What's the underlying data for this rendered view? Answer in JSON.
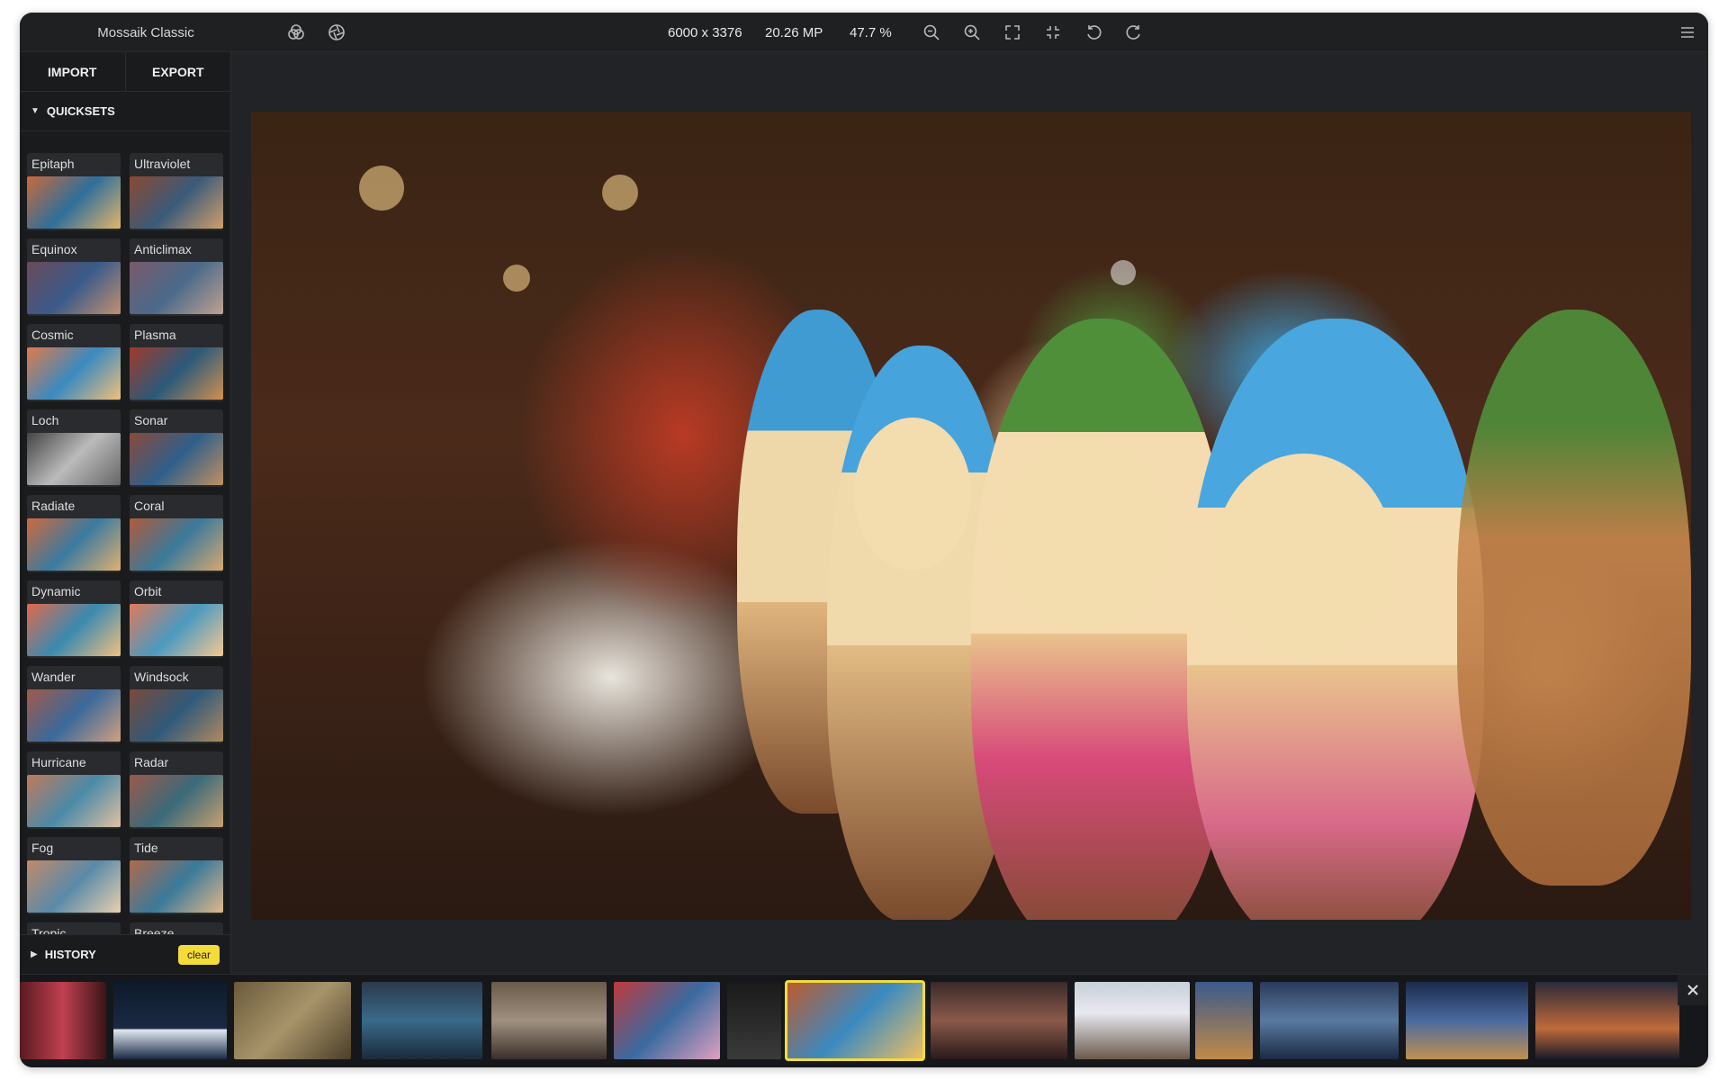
{
  "window": {
    "title": "Mossaik Classic"
  },
  "toolbar": {
    "resolution": "6000 x 3376",
    "megapixels": "20.26 MP",
    "zoom": "47.7 %",
    "icons": [
      "color-channels-icon",
      "lens-icon",
      "zoom-out-icon",
      "zoom-in-icon",
      "fit-screen-icon",
      "actual-size-icon",
      "rotate-left-icon",
      "rotate-right-icon",
      "menu-icon"
    ]
  },
  "sidebar": {
    "tabs": [
      "IMPORT",
      "EXPORT"
    ],
    "quicksets_label": "QUICKSETS",
    "presets": [
      "Epitaph",
      "Ultraviolet",
      "Equinox",
      "Anticlimax",
      "Cosmic",
      "Plasma",
      "Loch",
      "Sonar",
      "Radiate",
      "Coral",
      "Dynamic",
      "Orbit",
      "Wander",
      "Windsock",
      "Hurricane",
      "Radar",
      "Fog",
      "Tide",
      "Tropic",
      "Breeze"
    ],
    "history_label": "HISTORY",
    "clear_label": "clear"
  },
  "colors": {
    "accent": "#f3dc3a",
    "background": "#1d1e20"
  }
}
